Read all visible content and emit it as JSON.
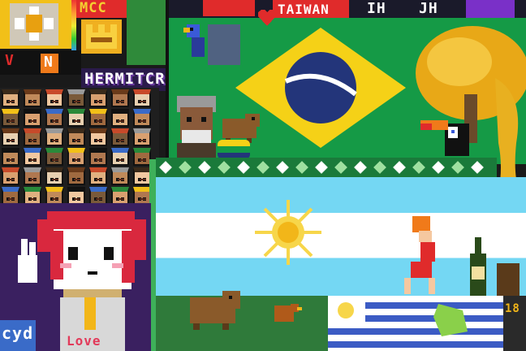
{
  "labels": {
    "mcc": "MCC",
    "taiwan": "TAIWAN",
    "hermitcraft": "HERMITCRAFT",
    "hermit_tag": "H",
    "love": "Love",
    "cyd": "cyd",
    "v_letter": "V",
    "n_letter": "N",
    "ih": "IH",
    "jh": "JH",
    "num": "18"
  },
  "colors": {
    "brazil_green": "#159a46",
    "brazil_yellow": "#f5d117",
    "brazil_blue": "#23357a",
    "argentina_blue": "#74d7f3",
    "argentina_white": "#ffffff",
    "sun": "#f7d64a",
    "uruguay_blue": "#3b5bc4",
    "tree_gold": "#e8a817",
    "hair_red": "#d9283e",
    "background_dark": "#1a1a1a"
  },
  "icons": [
    "sun-icon",
    "heart-icon",
    "parrot-icon",
    "capybara-icon",
    "toucan-icon",
    "trophy-icon",
    "wine-bottle-icon",
    "star-icon"
  ]
}
